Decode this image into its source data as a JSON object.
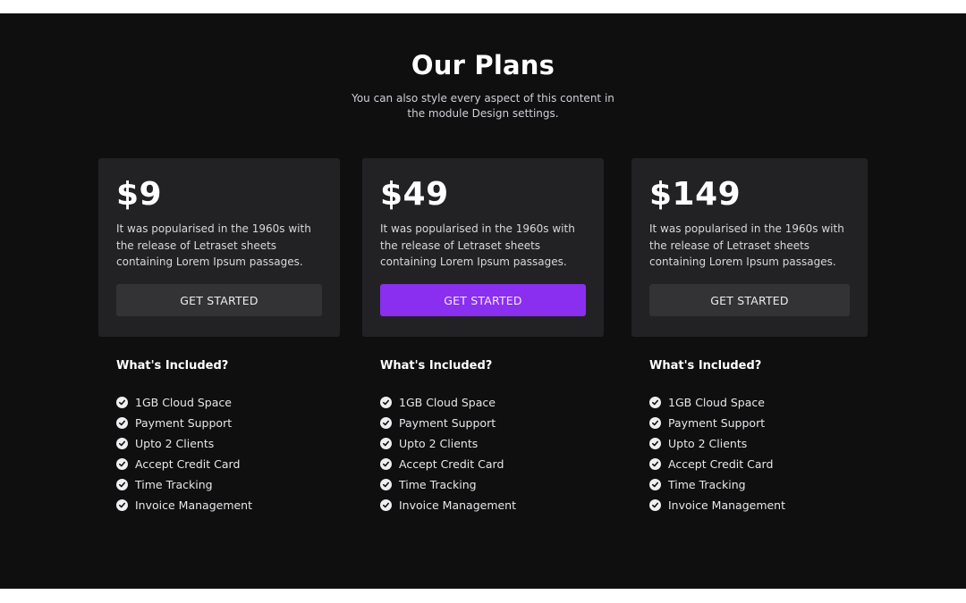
{
  "header": {
    "title": "Our Plans",
    "subtitle": "You can also style every aspect of this content in the module Design settings."
  },
  "plans": [
    {
      "price": "$9",
      "description": "It was popularised in the 1960s with the release of Letraset sheets containing Lorem Ipsum passages.",
      "button_label": "GET STARTED",
      "included_title": "What's Included?",
      "features": [
        "1GB Cloud Space",
        "Payment Support",
        "Upto 2 Clients",
        "Accept Credit Card",
        "Time Tracking",
        "Invoice Management"
      ]
    },
    {
      "price": "$49",
      "description": "It was popularised in the 1960s with the release of Letraset sheets containing Lorem Ipsum passages.",
      "button_label": "GET STARTED",
      "featured": true,
      "included_title": "What's Included?",
      "features": [
        "1GB Cloud Space",
        "Payment Support",
        "Upto 2 Clients",
        "Accept Credit Card",
        "Time Tracking",
        "Invoice Management"
      ]
    },
    {
      "price": "$149",
      "description": "It was popularised in the 1960s with the release of Letraset sheets containing Lorem Ipsum passages.",
      "button_label": "GET STARTED",
      "included_title": "What's Included?",
      "features": [
        "1GB Cloud Space",
        "Payment Support",
        "Upto 2 Clients",
        "Accept Credit Card",
        "Time Tracking",
        "Invoice Management"
      ]
    }
  ],
  "colors": {
    "background": "#0f0f10",
    "card": "#222224",
    "button": "#333335",
    "accent": "#8a2ff0"
  },
  "icons": {
    "feature_check": "check-circle-icon"
  }
}
